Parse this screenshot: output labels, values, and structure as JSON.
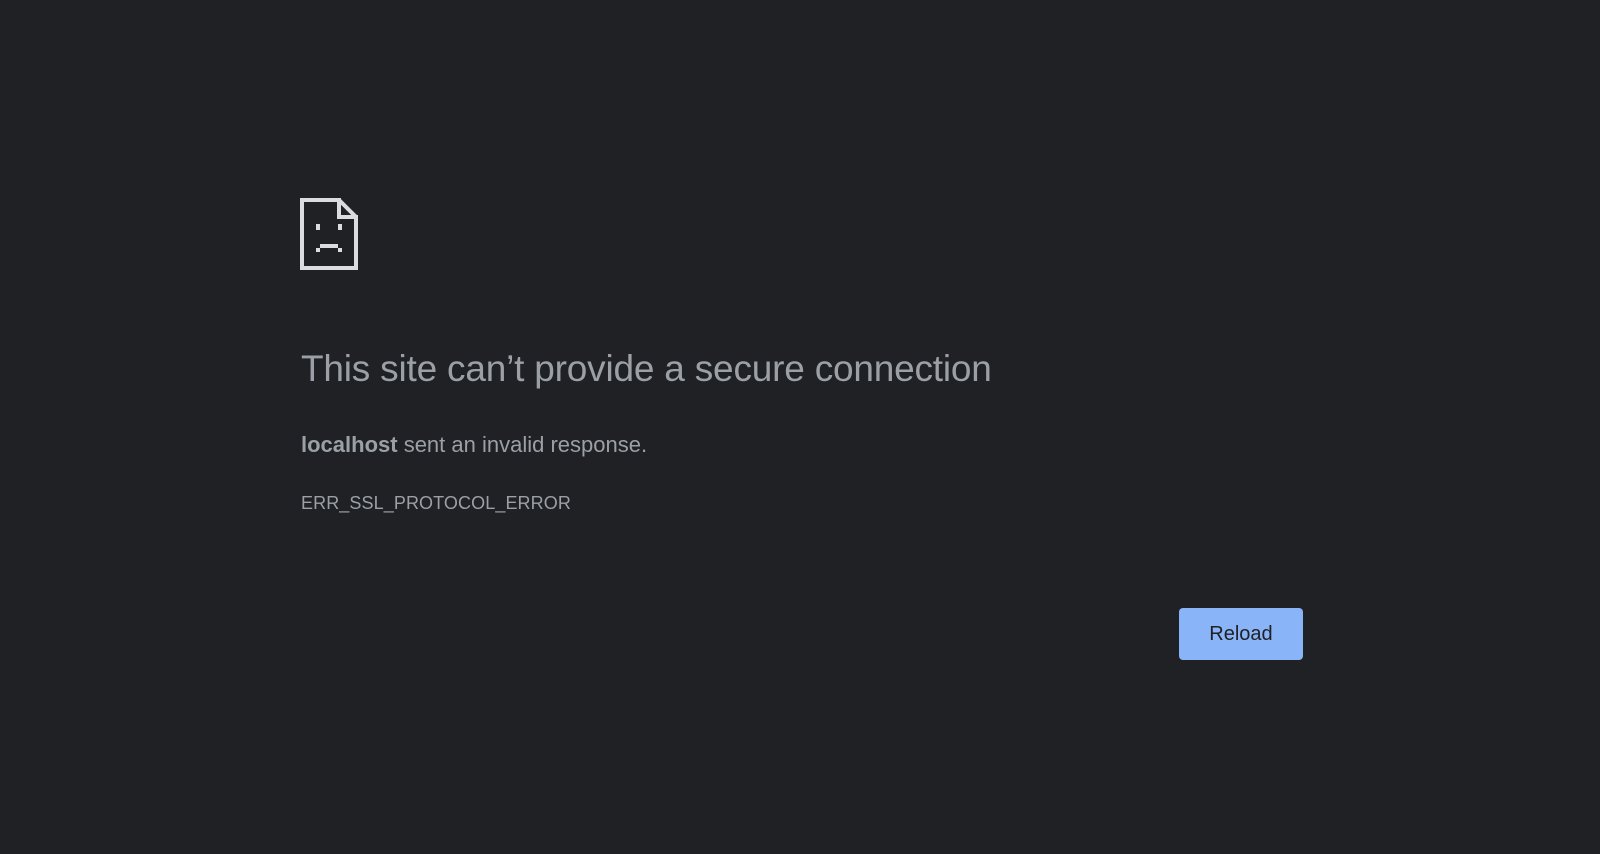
{
  "page": {
    "background_color": "#202124",
    "text_color": "#9aa0a6",
    "accent_color": "#8ab4f8"
  },
  "icon": {
    "name": "sad-document-icon",
    "color": "#dadce0"
  },
  "heading": "This site can’t provide a secure connection",
  "summary": {
    "host": "localhost",
    "message": " sent an invalid response."
  },
  "error_code": "ERR_SSL_PROTOCOL_ERROR",
  "buttons": {
    "reload_label": "Reload"
  }
}
